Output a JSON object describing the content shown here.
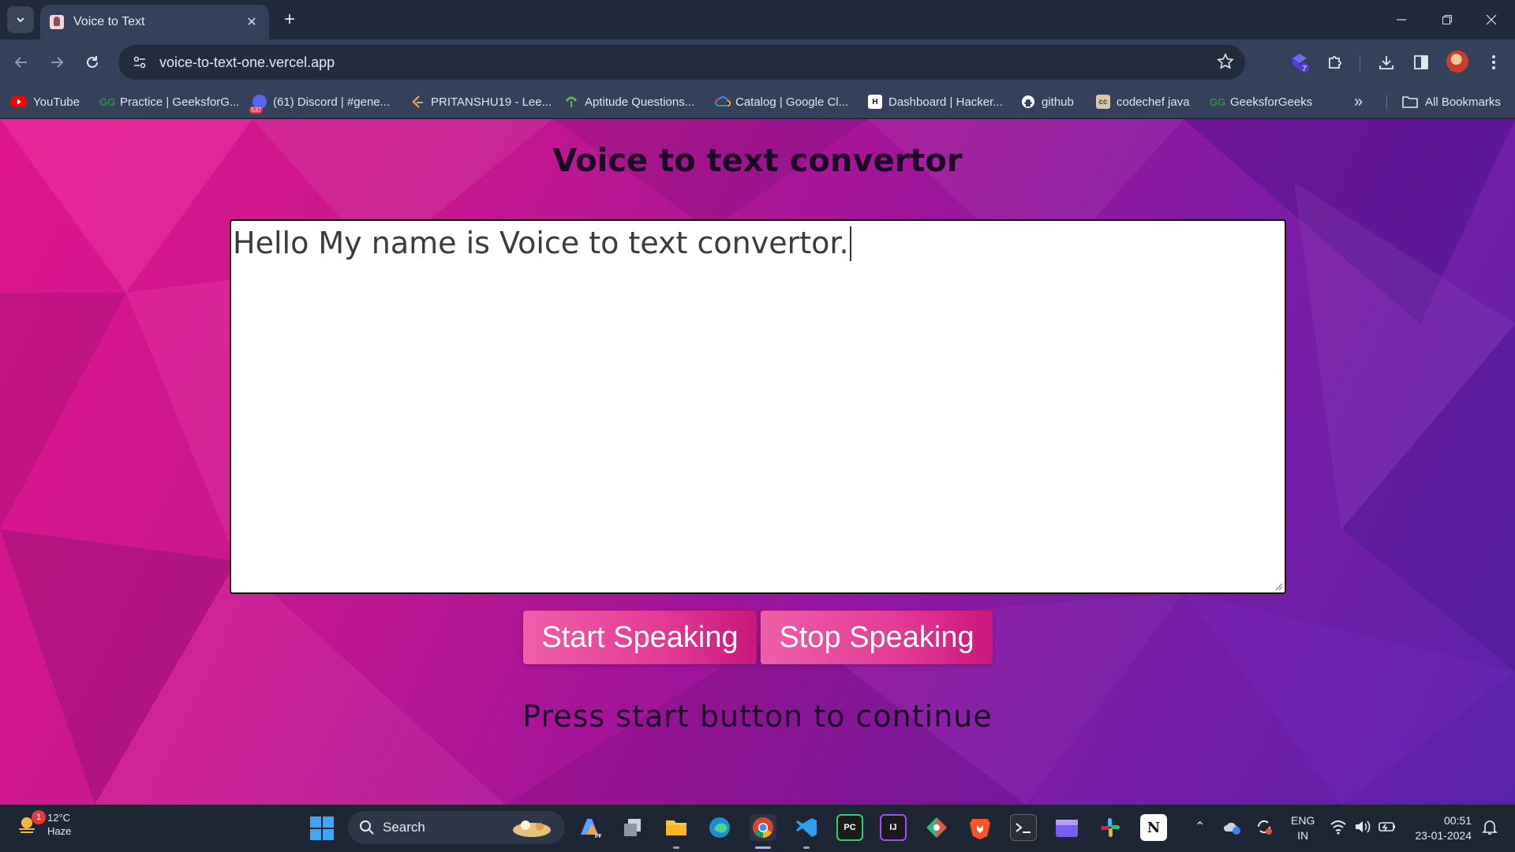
{
  "browser": {
    "tab_title": "Voice to Text",
    "url": "voice-to-text-one.vercel.app",
    "extensions_badge": "7"
  },
  "bookmarks": [
    {
      "label": "YouTube",
      "icon": "youtube-icon",
      "color": "#ff0000"
    },
    {
      "label": "Practice | GeeksforG...",
      "icon": "geeksforgeeks-icon",
      "color": "#2f8d46"
    },
    {
      "label": "(61) Discord | #gene...",
      "icon": "discord-icon",
      "color": "#5865f2",
      "badge": "537"
    },
    {
      "label": "PRITANSHU19 - Lee...",
      "icon": "leetcode-icon",
      "color": "#f4a53a"
    },
    {
      "label": "Aptitude Questions...",
      "icon": "indiabix-icon",
      "color": "#6ab04c"
    },
    {
      "label": "Catalog | Google Cl...",
      "icon": "google-cloud-icon",
      "color": "#4285f4"
    },
    {
      "label": "Dashboard | Hacker...",
      "icon": "hackerrank-icon",
      "color": "#111111"
    },
    {
      "label": "github",
      "icon": "github-icon",
      "color": "#ffffff"
    },
    {
      "label": "codechef java",
      "icon": "codechef-icon",
      "color": "#d9c7a8"
    },
    {
      "label": "GeeksforGeeks",
      "icon": "geeksforgeeks-icon",
      "color": "#2f8d46"
    }
  ],
  "all_bookmarks_label": "All Bookmarks",
  "page": {
    "title": "Voice to text convertor",
    "transcript": "Hello My name is Voice to text convertor.",
    "start_label": "Start Speaking",
    "stop_label": "Stop Speaking",
    "status": "Press start button to continue"
  },
  "taskbar": {
    "weather_temp": "12°C",
    "weather_desc": "Haze",
    "weather_badge": "1",
    "search_label": "Search",
    "lang_line1": "ENG",
    "lang_line2": "IN",
    "time": "00:51",
    "date": "23-01-2024"
  },
  "colors": {
    "page_gradient_start": "#e0168f",
    "page_gradient_end": "#5a22aa",
    "button_pink": "#e33a95",
    "chrome_dark": "#202a3a",
    "chrome_toolbar": "#35415a"
  }
}
